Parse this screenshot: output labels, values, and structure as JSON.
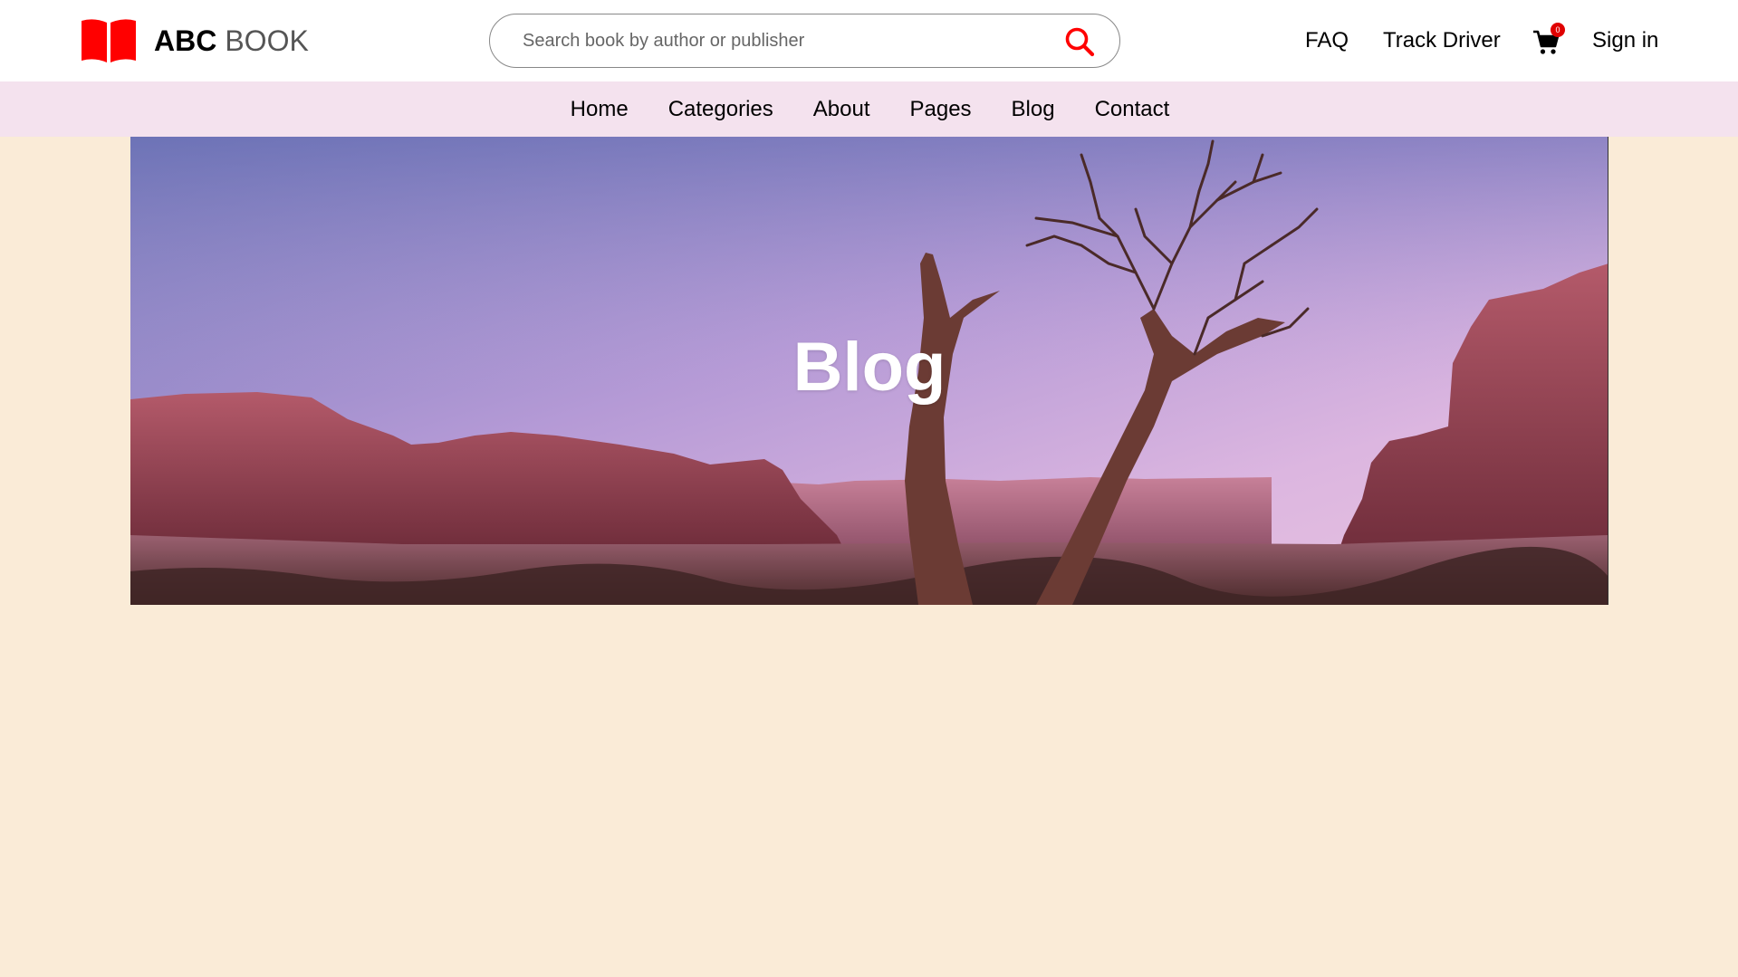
{
  "header": {
    "logo": {
      "icon": "open-book-icon",
      "brand_bold": "ABC",
      "brand_light": "BOOK",
      "color": "#ff0000"
    },
    "search": {
      "placeholder": "Search book by author or publisher",
      "value": "",
      "icon": "search-icon"
    },
    "links": {
      "faq": "FAQ",
      "track_driver": "Track Driver",
      "sign_in": "Sign in"
    },
    "cart": {
      "icon": "shopping-cart-icon",
      "count": "0",
      "badge_color": "#e00000"
    }
  },
  "nav": {
    "items": [
      "Home",
      "Categories",
      "About",
      "Pages",
      "Blog",
      "Contact"
    ],
    "background": "#f4e2ee"
  },
  "hero": {
    "title": "Blog",
    "image": "desert-canyon-with-dead-tree"
  },
  "colors": {
    "page_background": "#faebd7",
    "accent": "#ff0000"
  }
}
